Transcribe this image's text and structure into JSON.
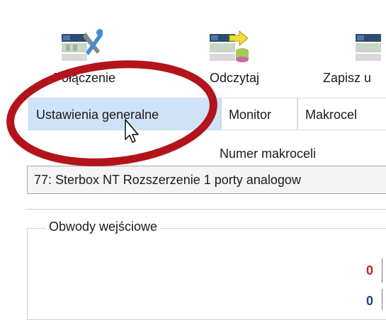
{
  "toolbar": {
    "connect_label": "Połączenie",
    "connect_icon": "device-tools-icon",
    "read_label": "Odczytaj",
    "read_icon": "device-read-icon",
    "write_label": "Zapisz u",
    "write_icon": "device-write-icon"
  },
  "tabs": [
    {
      "label": "Ustawienia generalne",
      "selected": true
    },
    {
      "label": "Monitor",
      "selected": false
    },
    {
      "label": "Makrocel",
      "selected": false
    }
  ],
  "macrocell": {
    "label": "Numer makroceli",
    "selected_value": "77: Sterbox NT Rozszerzenie 1 porty analogow"
  },
  "inputs_group": {
    "title": "Obwody wejściowe",
    "values": [
      "0",
      "0"
    ]
  },
  "colors": {
    "annotation_ring": "#b3141c",
    "selected_tab_bg": "#cfe3f7",
    "value_red": "#c0261d",
    "value_blue": "#1f3f8f"
  }
}
